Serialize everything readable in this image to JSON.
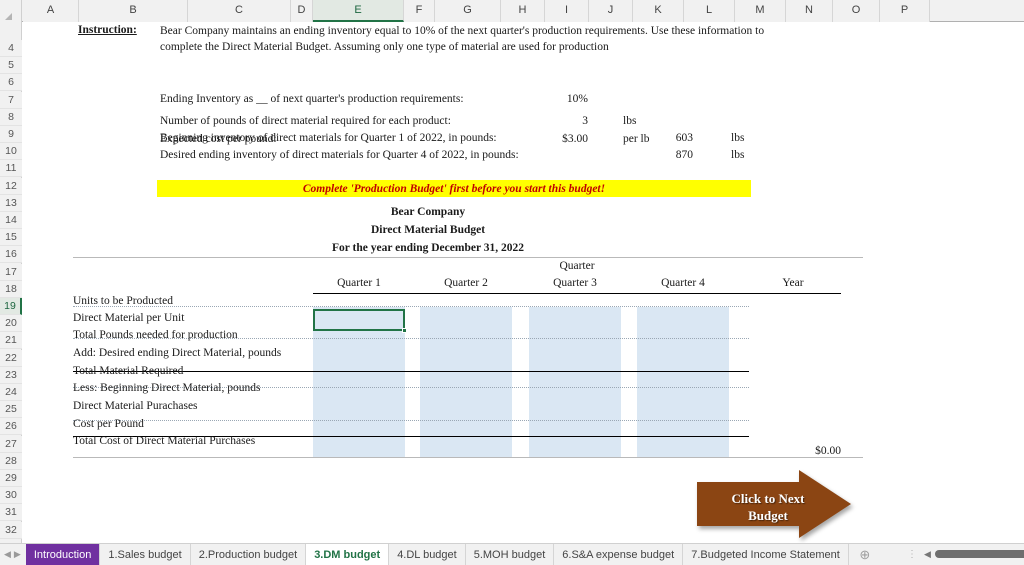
{
  "app": {
    "type": "spreadsheet"
  },
  "grid": {
    "columns": [
      "A",
      "B",
      "C",
      "D",
      "E",
      "F",
      "G",
      "H",
      "I",
      "J",
      "K",
      "L",
      "M",
      "N",
      "O",
      "P"
    ],
    "active_column": "E",
    "rows": [
      "4",
      "5",
      "6",
      "7",
      "8",
      "9",
      "10",
      "11",
      "12",
      "13",
      "14",
      "15",
      "16",
      "17",
      "18",
      "19",
      "20",
      "21",
      "22",
      "23",
      "24",
      "25",
      "26",
      "27",
      "28",
      "29",
      "30",
      "31",
      "32"
    ],
    "active_row": "19",
    "selected_cell": "E19"
  },
  "sheet": {
    "instruction_label": "Instruction:",
    "instruction_line1": "Bear Company maintains an ending inventory equal to 10% of the next quarter's production requirements. Use these information to",
    "instruction_line2": "complete the Direct Material Budget. Assuming only one type of material are used for production",
    "assumptions": [
      {
        "label": "Ending Inventory as __ of next quarter's production requirements:",
        "value": "10%",
        "unit": ""
      },
      {
        "label": "Number of pounds of direct material required for each product:",
        "value": "3",
        "unit": "lbs"
      },
      {
        "label": "Expected cost per pound:",
        "value": "$3.00",
        "unit": "per lb"
      }
    ],
    "inventory_rows": [
      {
        "label": "Beginning inventory of direct materials for Quarter 1 of 2022, in pounds:",
        "value": "603",
        "unit": "lbs"
      },
      {
        "label": "Desired ending inventory of direct materials for Quarter 4 of 2022, in pounds:",
        "value": "870",
        "unit": "lbs"
      }
    ],
    "warning": "Complete 'Production Budget' first before you start this budget!",
    "title_company": "Bear Company",
    "title_budget": "Direct Material Budget",
    "title_period": "For the year ending December 31, 2022",
    "quarter_group_header": "Quarter",
    "column_headers": [
      "Quarter 1",
      "Quarter 2",
      "Quarter 3",
      "Quarter 4",
      "Year"
    ],
    "line_items": [
      "Units to be Producted",
      "Direct Material per Unit",
      "Total Pounds needed for production",
      "Add: Desired ending Direct Material, pounds",
      "Total Material Required",
      "Less: Beginning Direct Material, pounds",
      "Direct Material Purachases",
      "Cost per Pound",
      "Total Cost of Direct Material Purchases"
    ],
    "year_total": "$0.00"
  },
  "callout": {
    "line1": "Click to Next",
    "line2": "Budget",
    "color": "#8b4513"
  },
  "tabs": [
    {
      "label": "Introduction",
      "state": "intro"
    },
    {
      "label": "1.Sales budget",
      "state": "normal"
    },
    {
      "label": "2.Production budget",
      "state": "normal"
    },
    {
      "label": "3.DM budget",
      "state": "active"
    },
    {
      "label": "4.DL budget",
      "state": "normal"
    },
    {
      "label": "5.MOH budget",
      "state": "normal"
    },
    {
      "label": "6.S&A expense budget",
      "state": "normal"
    },
    {
      "label": "7.Budgeted Income Statement",
      "state": "normal"
    }
  ],
  "tabbar": {
    "first_arrow": "◀",
    "prev_arrow": "◀",
    "next_arrow": "▶",
    "last_arrow": "▶",
    "add_sheet": "⊕",
    "scroll_left": "◀",
    "scroll_right": "▶",
    "menu_dots": "⋮"
  }
}
